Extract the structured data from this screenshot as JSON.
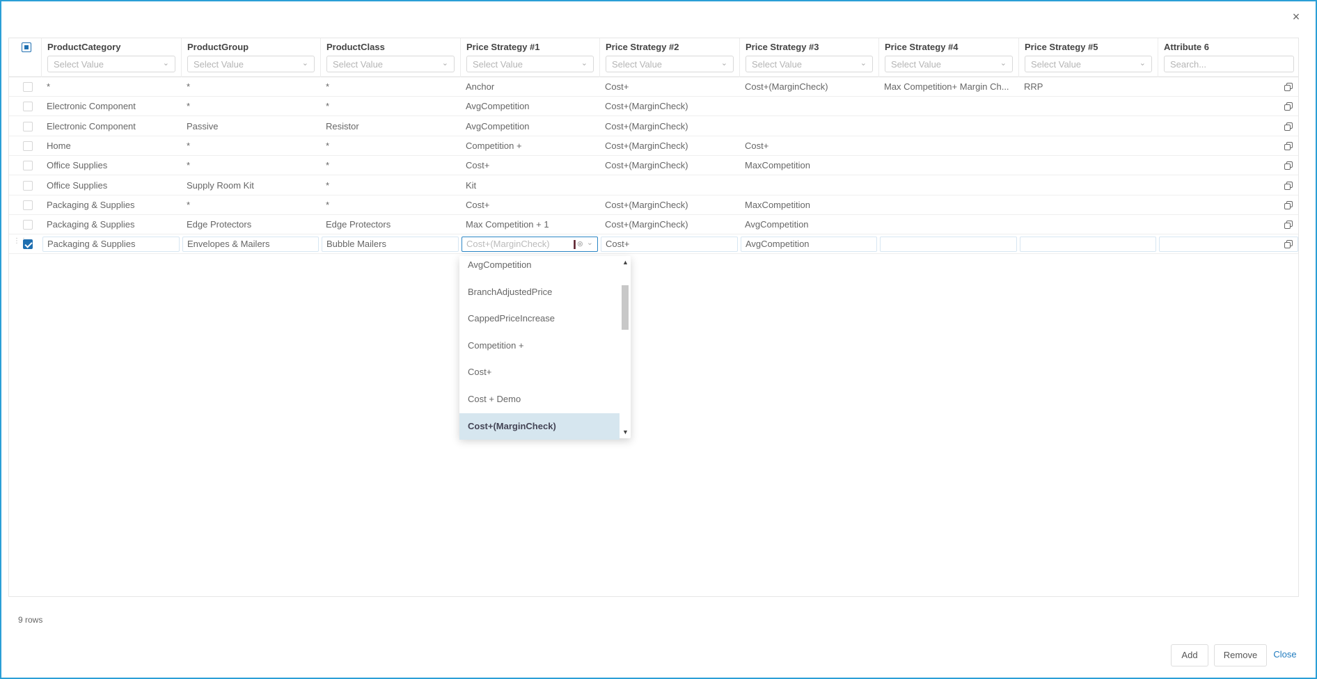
{
  "dialog": {
    "close_glyph": "×"
  },
  "columns": [
    {
      "title": "",
      "filter": ""
    },
    {
      "title": "ProductCategory",
      "filter": "Select Value"
    },
    {
      "title": "ProductGroup",
      "filter": "Select Value"
    },
    {
      "title": "ProductClass",
      "filter": "Select Value"
    },
    {
      "title": "Price Strategy #1",
      "filter": "Select Value"
    },
    {
      "title": "Price Strategy #2",
      "filter": "Select Value"
    },
    {
      "title": "Price Strategy #3",
      "filter": "Select Value"
    },
    {
      "title": "Price Strategy #4",
      "filter": "Select Value"
    },
    {
      "title": "Price Strategy #5",
      "filter": "Select Value"
    },
    {
      "title": "Attribute 6",
      "filter": "Search..."
    }
  ],
  "rows": [
    [
      "*",
      "*",
      "*",
      "Anchor",
      "Cost+",
      "Cost+(MarginCheck)",
      "Max Competition+ Margin Ch...",
      "RRP",
      ""
    ],
    [
      "Electronic Component",
      "*",
      "*",
      "AvgCompetition",
      "Cost+(MarginCheck)",
      "",
      "",
      "",
      ""
    ],
    [
      "Electronic Component",
      "Passive",
      "Resistor",
      "AvgCompetition",
      "Cost+(MarginCheck)",
      "",
      "",
      "",
      ""
    ],
    [
      "Home",
      "*",
      "*",
      "Competition +",
      "Cost+(MarginCheck)",
      "Cost+",
      "",
      "",
      ""
    ],
    [
      "Office Supplies",
      "*",
      "*",
      "Cost+",
      "Cost+(MarginCheck)",
      "MaxCompetition",
      "",
      "",
      ""
    ],
    [
      "Office Supplies",
      "Supply Room Kit",
      "*",
      "Kit",
      "",
      "",
      "",
      "",
      ""
    ],
    [
      "Packaging & Supplies",
      "*",
      "*",
      "Cost+",
      "Cost+(MarginCheck)",
      "MaxCompetition",
      "",
      "",
      ""
    ],
    [
      "Packaging & Supplies",
      "Edge Protectors",
      "Edge Protectors",
      "Max Competition + 1",
      "Cost+(MarginCheck)",
      "AvgCompetition",
      "",
      "",
      ""
    ]
  ],
  "edit_row": [
    "Packaging & Supplies",
    "Envelopes & Mailers",
    "Bubble Mailers",
    "Cost+(MarginCheck)",
    "Cost+",
    "AvgCompetition",
    "",
    "",
    ""
  ],
  "dropdown": {
    "items": [
      "AvgCompetition",
      "BranchAdjustedPrice",
      "CappedPriceIncrease",
      "Competition +",
      "Cost+",
      "Cost + Demo",
      "Cost+(MarginCheck)"
    ],
    "selected_index": 6
  },
  "footer": {
    "rows_count": "9 rows",
    "add": "Add",
    "remove": "Remove",
    "close": "Close"
  },
  "colors": {
    "accent": "#2b9fd6",
    "check": "#1f6fb0",
    "selected_bg": "#d6e6ef"
  }
}
